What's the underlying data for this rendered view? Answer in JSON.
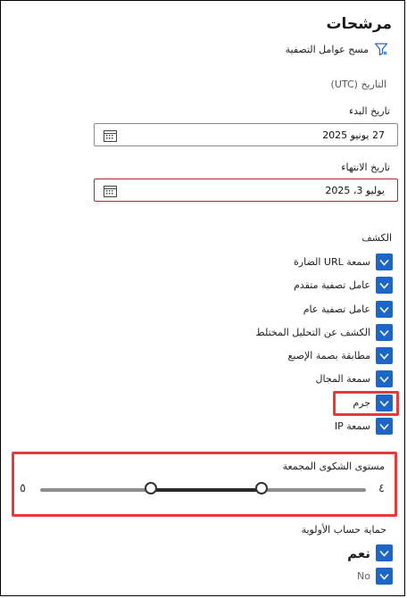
{
  "panel": {
    "title": "مرشحات",
    "clear_filters": "مسح عوامل التصفية",
    "date_label": "التاريخ (UTC)"
  },
  "start_date": {
    "label": "تاريخ البدء",
    "value": "27 يونيو 2025"
  },
  "end_date": {
    "label": "تاريخ الانتهاء",
    "value": "يوليو 3، 2025"
  },
  "detection": {
    "label": "الكشف",
    "items": [
      {
        "label": "سمعة URL الضارة",
        "checked": true
      },
      {
        "label": "عامل تصفية متقدم",
        "checked": true
      },
      {
        "label": "عامل تصفية عام",
        "checked": true
      },
      {
        "label": "الكشف عن التحليل المختلط",
        "checked": true
      },
      {
        "label": "مطابقة بصمة الإصبع",
        "checked": true
      },
      {
        "label": "سمعة المجال",
        "checked": true
      },
      {
        "label": "جرم",
        "checked": true
      },
      {
        "label": "سمعة IP",
        "checked": true
      }
    ]
  },
  "slider": {
    "title": "مستوى الشكوى المجمعة",
    "min_label": "٥",
    "max_label": "٤",
    "scale_min": 0,
    "scale_max": 10,
    "low_value": 3.4,
    "high_value": 6.8
  },
  "priority": {
    "label": "حماية حساب الأولوية",
    "yes_label": "نعم",
    "no_label": "No",
    "yes_checked": true,
    "no_checked": true
  },
  "colors": {
    "accent": "#1b67c9",
    "highlight": "#e53a3a",
    "error_border": "#b3262e"
  }
}
